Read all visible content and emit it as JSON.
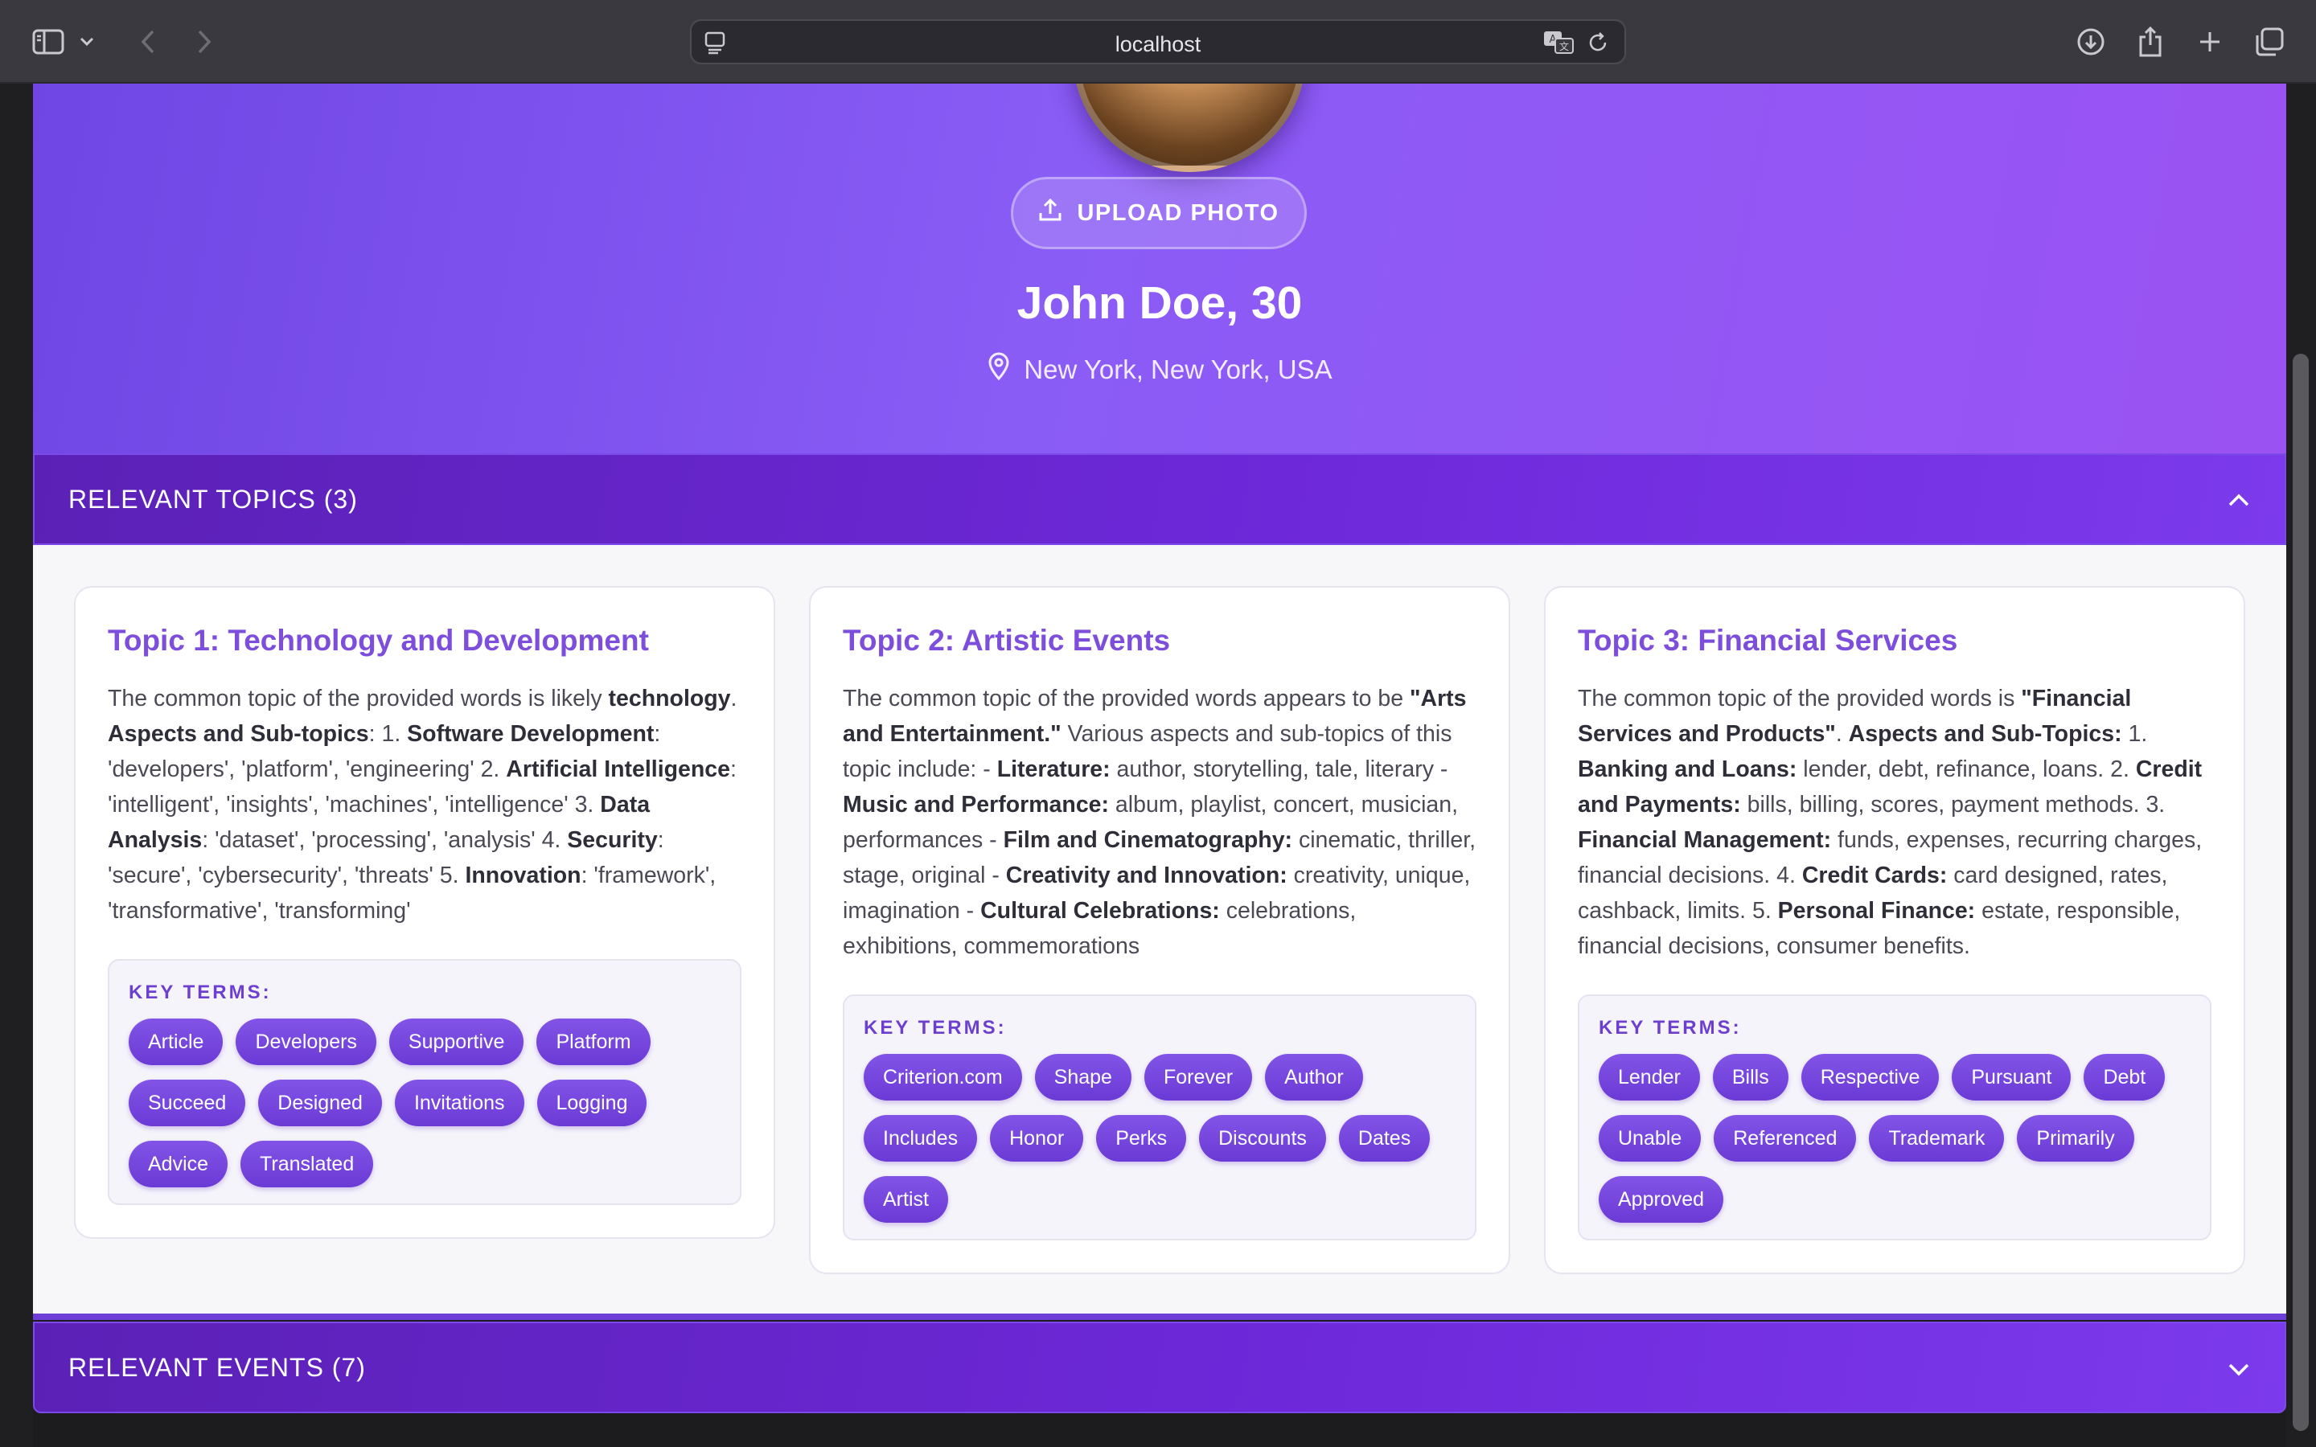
{
  "browser": {
    "address": "localhost"
  },
  "profile": {
    "upload_label": "UPLOAD PHOTO",
    "name": "John Doe, 30",
    "location": "New York, New York, USA"
  },
  "sections": {
    "topics_header": "RELEVANT TOPICS (3)",
    "events_header": "RELEVANT EVENTS (7)"
  },
  "key_terms_label": "KEY TERMS:",
  "topics": [
    {
      "title": "Topic 1: Technology and Development",
      "terms": [
        "Article",
        "Developers",
        "Supportive",
        "Platform",
        "Succeed",
        "Designed",
        "Invitations",
        "Logging",
        "Advice",
        "Translated"
      ]
    },
    {
      "title": "Topic 2: Artistic Events",
      "terms": [
        "Criterion.com",
        "Shape",
        "Forever",
        "Author",
        "Includes",
        "Honor",
        "Perks",
        "Discounts",
        "Dates",
        "Artist"
      ]
    },
    {
      "title": "Topic 3: Financial Services",
      "terms": [
        "Lender",
        "Bills",
        "Respective",
        "Pursuant",
        "Debt",
        "Unable",
        "Referenced",
        "Trademark",
        "Primarily",
        "Approved"
      ]
    }
  ],
  "topic_descriptions": [
    [
      {
        "t": "The common topic of the provided words is likely "
      },
      {
        "t": "technology",
        "b": true
      },
      {
        "t": ". "
      },
      {
        "t": "Aspects and Sub-topics",
        "b": true
      },
      {
        "t": ": 1. "
      },
      {
        "t": "Software Development",
        "b": true
      },
      {
        "t": ": 'developers', 'platform', 'engineering' 2. "
      },
      {
        "t": "Artificial Intelligence",
        "b": true
      },
      {
        "t": ": 'intelligent', 'insights', 'machines', 'intelligence' 3. "
      },
      {
        "t": "Data Analysis",
        "b": true
      },
      {
        "t": ": 'dataset', 'processing', 'analysis' 4. "
      },
      {
        "t": "Security",
        "b": true
      },
      {
        "t": ": 'secure', 'cybersecurity', 'threats' 5. "
      },
      {
        "t": "Innovation",
        "b": true
      },
      {
        "t": ": 'framework', 'transformative', 'transforming'"
      }
    ],
    [
      {
        "t": "The common topic of the provided words appears to be "
      },
      {
        "t": "\"Arts and Entertainment.\"",
        "b": true
      },
      {
        "t": " Various aspects and sub-topics of this topic include: - "
      },
      {
        "t": "Literature:",
        "b": true
      },
      {
        "t": " author, storytelling, tale, literary - "
      },
      {
        "t": "Music and Performance:",
        "b": true
      },
      {
        "t": " album, playlist, concert, musician, performances - "
      },
      {
        "t": "Film and Cinematography:",
        "b": true
      },
      {
        "t": " cinematic, thriller, stage, original - "
      },
      {
        "t": "Creativity and Innovation:",
        "b": true
      },
      {
        "t": " creativity, unique, imagination - "
      },
      {
        "t": "Cultural Celebrations:",
        "b": true
      },
      {
        "t": " celebrations, exhibitions, commemorations"
      }
    ],
    [
      {
        "t": "The common topic of the provided words is "
      },
      {
        "t": "\"Financial Services and Products\"",
        "b": true
      },
      {
        "t": ". "
      },
      {
        "t": "Aspects and Sub-Topics:",
        "b": true
      },
      {
        "t": " 1. "
      },
      {
        "t": "Banking and Loans:",
        "b": true
      },
      {
        "t": " lender, debt, refinance, loans. 2. "
      },
      {
        "t": "Credit and Payments:",
        "b": true
      },
      {
        "t": " bills, billing, scores, payment methods. 3. "
      },
      {
        "t": "Financial Management:",
        "b": true
      },
      {
        "t": " funds, expenses, recurring charges, financial decisions. 4. "
      },
      {
        "t": "Credit Cards:",
        "b": true
      },
      {
        "t": " card designed, rates, cashback, limits. 5. "
      },
      {
        "t": "Personal Finance:",
        "b": true
      },
      {
        "t": " estate, responsible, financial decisions, consumer benefits."
      }
    ]
  ],
  "icons": {
    "sidebar": "sidebar-icon",
    "back": "chevron-left-icon",
    "forward": "chevron-right-icon",
    "page": "page-menu-icon",
    "translate": "translate-icon",
    "reload": "reload-icon",
    "download": "download-icon",
    "share": "share-icon",
    "new_tab": "plus-icon",
    "tabs": "tab-overview-icon",
    "upload": "upload-icon",
    "location": "map-pin-icon",
    "collapse": "chevron-up-icon",
    "expand": "chevron-down-icon"
  },
  "colors": {
    "accent": "#7c3aed",
    "topic_title": "#7d4ddb",
    "chip": "#7446dd"
  }
}
